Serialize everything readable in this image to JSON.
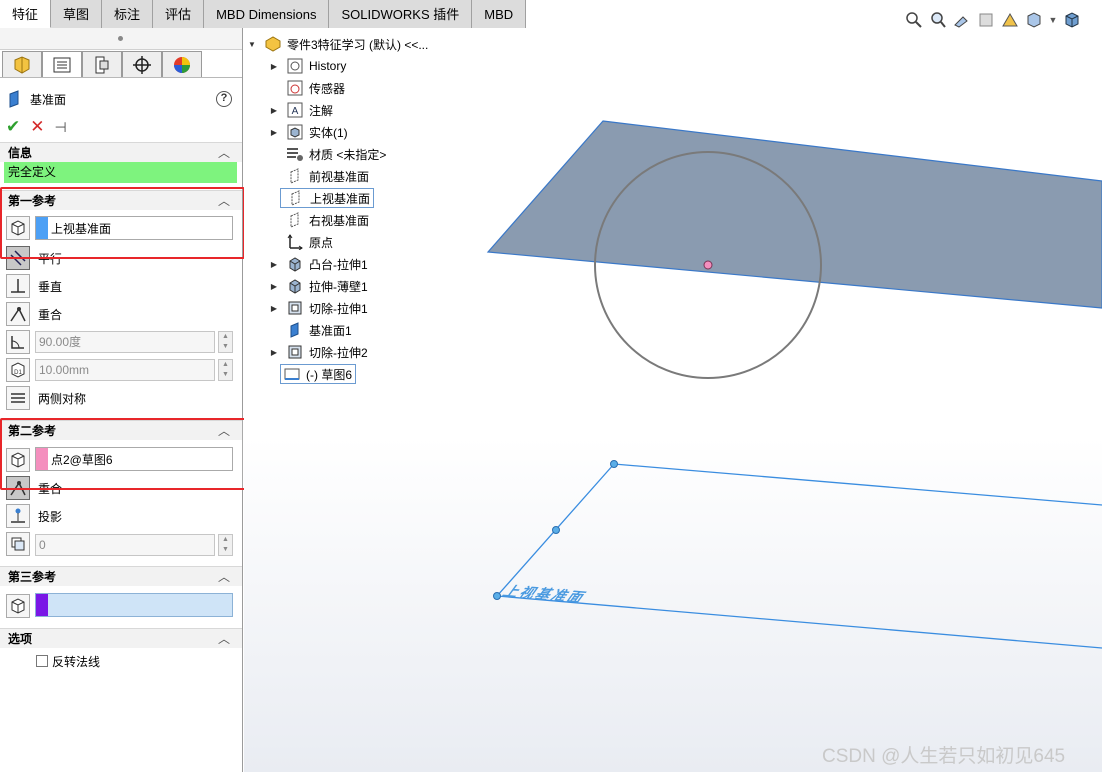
{
  "tabs": [
    "特征",
    "草图",
    "标注",
    "评估",
    "MBD Dimensions",
    "SOLIDWORKS 插件",
    "MBD"
  ],
  "active_tab_index": 0,
  "property_manager": {
    "title": "基准面",
    "help_icon": "?",
    "ok_icon": "✔",
    "cancel_icon": "✕",
    "pin_icon": "⊣"
  },
  "info": {
    "header": "信息",
    "status": "完全定义",
    "status_color": "#7ef37e"
  },
  "first_ref": {
    "header": "第一参考",
    "selection": "上视基准面",
    "swatch_color": "#4da0f5",
    "options": [
      "平行",
      "垂直",
      "重合"
    ],
    "angle_value": "90.00度",
    "distance_value": "10.00mm",
    "symmetric_label": "两侧对称"
  },
  "second_ref": {
    "header": "第二参考",
    "selection": "点2@草图6",
    "swatch_color": "#f48fbe",
    "options": [
      "重合",
      "投影"
    ],
    "count_value": "0"
  },
  "third_ref": {
    "header": "第三参考",
    "swatch_color": "#7a17e6"
  },
  "options_section": {
    "header": "选项",
    "flip_normal_label": "反转法线"
  },
  "tree": {
    "root": "零件3特征学习 (默认) <<...",
    "items": [
      {
        "label": "History",
        "expandable": true
      },
      {
        "label": "传感器",
        "expandable": false
      },
      {
        "label": "注解",
        "expandable": true
      },
      {
        "label": "实体(1)",
        "expandable": true
      },
      {
        "label": "材质 <未指定>",
        "expandable": false
      },
      {
        "label": "前视基准面",
        "expandable": false
      },
      {
        "label": "上视基准面",
        "expandable": false
      },
      {
        "label": "右视基准面",
        "expandable": false
      },
      {
        "label": "原点",
        "expandable": false
      },
      {
        "label": "凸台-拉伸1",
        "expandable": true
      },
      {
        "label": "拉伸-薄壁1",
        "expandable": true
      },
      {
        "label": "切除-拉伸1",
        "expandable": true
      },
      {
        "label": "基准面1",
        "expandable": false
      },
      {
        "label": "切除-拉伸2",
        "expandable": true
      },
      {
        "label": "(-) 草图6",
        "expandable": false
      }
    ]
  },
  "viewport": {
    "plane_label": "上视基准面",
    "plane_fill": "#8a9bb0",
    "plane_edge": "#3a78c8",
    "point_color": "#f48fbe"
  },
  "watermark": "CSDN @人生若只如初见645"
}
